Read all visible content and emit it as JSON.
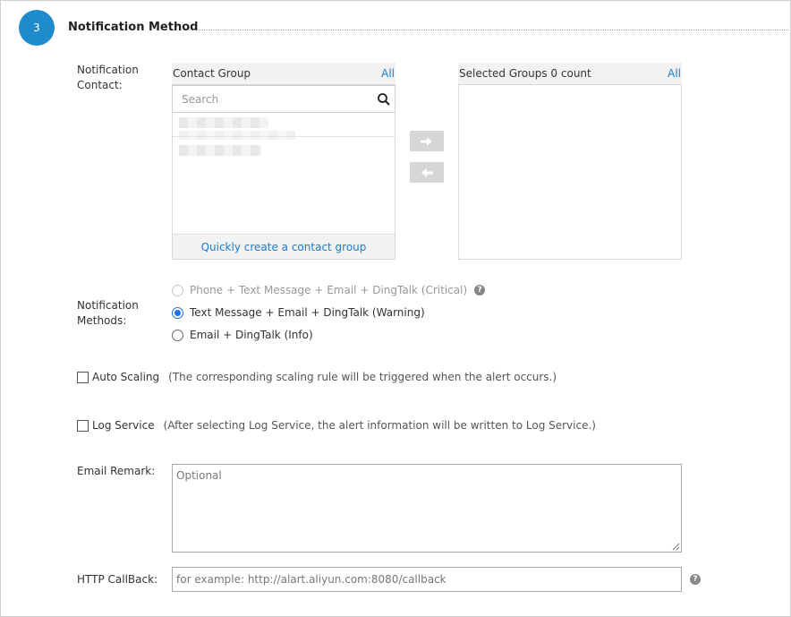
{
  "section": {
    "step_number": "3",
    "title": "Notification Method"
  },
  "notification_contact": {
    "label_line1": "Notification",
    "label_line2": "Contact:",
    "contact_group": {
      "header": "Contact Group",
      "all_link": "All",
      "search_placeholder": "Search",
      "quick_create": "Quickly create a contact group"
    },
    "selected_groups": {
      "header": "Selected Groups 0 count",
      "all_link": "All"
    },
    "move_right_icon": "arrow-right-icon",
    "move_left_icon": "arrow-left-icon"
  },
  "notification_methods": {
    "label_line1": "Notification",
    "label_line2": "Methods:",
    "options": [
      {
        "text": "Phone + Text Message + Email + DingTalk (Critical)",
        "state": "disabled"
      },
      {
        "text": "Text Message + Email + DingTalk (Warning)",
        "state": "checked"
      },
      {
        "text": "Email + DingTalk (Info)",
        "state": "unchecked"
      }
    ]
  },
  "auto_scaling": {
    "label": "Auto Scaling",
    "note": "(The corresponding scaling rule will be triggered when the alert occurs.)"
  },
  "log_service": {
    "label": "Log Service",
    "note": "(After selecting Log Service, the alert information will be written to Log Service.)"
  },
  "email_remark": {
    "label": "Email Remark:",
    "placeholder": "Optional"
  },
  "http_callback": {
    "label": "HTTP CallBack:",
    "placeholder": "for example: http://alart.aliyun.com:8080/callback"
  },
  "colors": {
    "accent": "#1e8ccc",
    "link": "#1e7bc8",
    "radio_checked": "#1a73e8"
  }
}
